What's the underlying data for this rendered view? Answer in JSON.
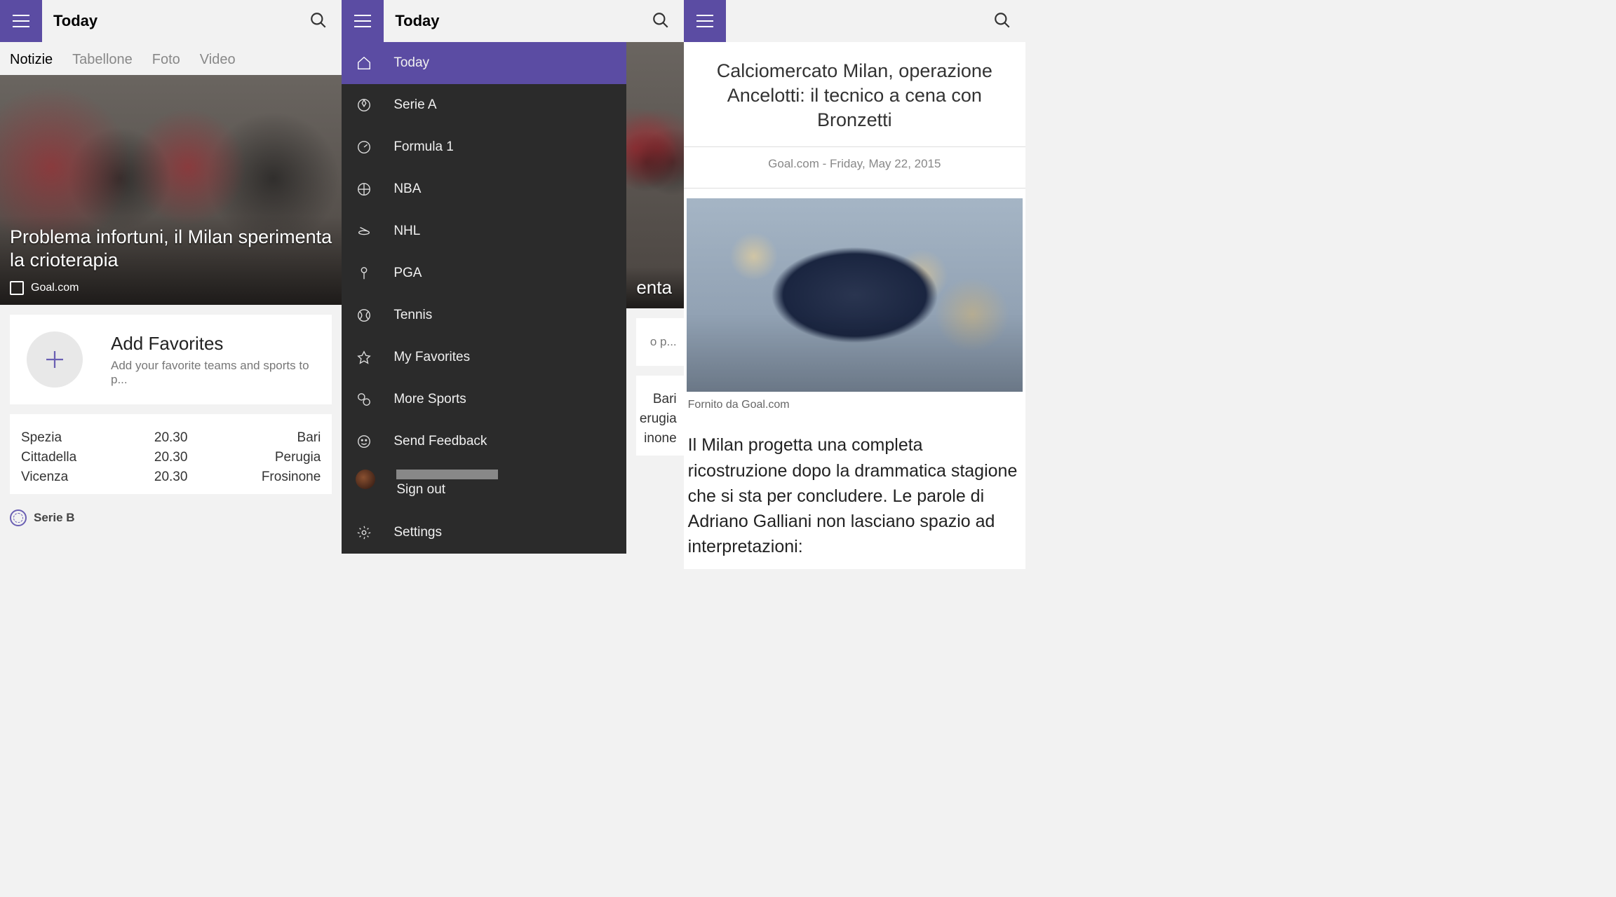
{
  "header": {
    "title": "Today"
  },
  "tabs": [
    "Notizie",
    "Tabellone",
    "Foto",
    "Video"
  ],
  "hero": {
    "title": "Problema infortuni, il Milan sperimenta la crioterapia",
    "source": "Goal.com"
  },
  "favorites": {
    "title": "Add Favorites",
    "subtitle": "Add your favorite teams and sports to p..."
  },
  "scores": [
    {
      "left": "Spezia",
      "time": "20.30",
      "right": "Bari"
    },
    {
      "left": "Cittadella",
      "time": "20.30",
      "right": "Perugia"
    },
    {
      "left": "Vicenza",
      "time": "20.30",
      "right": "Frosinone"
    }
  ],
  "league": "Serie B",
  "drawer": {
    "items": [
      {
        "label": "Today",
        "icon": "home",
        "active": true
      },
      {
        "label": "Serie A",
        "icon": "soccer"
      },
      {
        "label": "Formula 1",
        "icon": "speed"
      },
      {
        "label": "NBA",
        "icon": "basketball"
      },
      {
        "label": "NHL",
        "icon": "puck"
      },
      {
        "label": "PGA",
        "icon": "golf"
      },
      {
        "label": "Tennis",
        "icon": "tennis"
      },
      {
        "label": "My Favorites",
        "icon": "star"
      },
      {
        "label": "More Sports",
        "icon": "more"
      },
      {
        "label": "Send Feedback",
        "icon": "smile"
      }
    ],
    "signout": "Sign out",
    "settings": "Settings"
  },
  "peek": {
    "hero_fragment": "enta",
    "fav_fragment": "o p...",
    "scores": [
      "Bari",
      "erugia",
      "inone"
    ]
  },
  "article": {
    "title": "Calciomercato Milan, operazione Ancelotti: il tecnico a cena con Bronzetti",
    "meta": "Goal.com - Friday, May 22, 2015",
    "credit": "Fornito da Goal.com",
    "body": "Il Milan progetta una completa ricostruzione dopo la drammatica stagione che si sta per concludere. Le parole di Adriano Galliani non lasciano spazio ad interpretazioni:"
  }
}
